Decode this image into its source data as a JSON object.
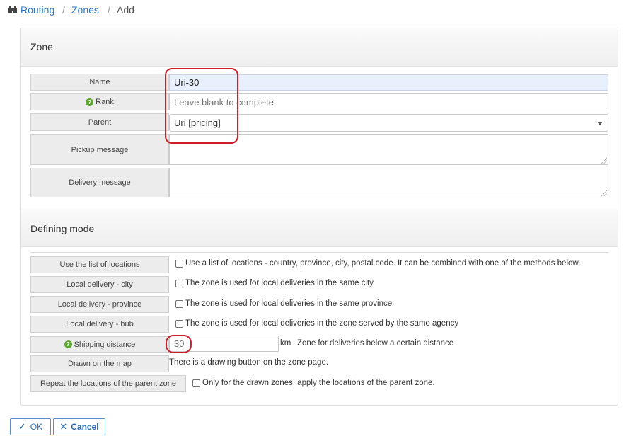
{
  "breadcrumb": {
    "items": [
      "Routing",
      "Zones",
      "Add"
    ],
    "separator": "/",
    "icon": "binoculars-icon"
  },
  "zone_section": {
    "title": "Zone",
    "fields": {
      "name": {
        "label": "Name",
        "value": "Uri-30"
      },
      "rank": {
        "label": "Rank",
        "placeholder": "Leave blank to complete",
        "help_icon": "question-circle-icon"
      },
      "parent": {
        "label": "Parent",
        "selected": "Uri [pricing]"
      },
      "pickup_message": {
        "label": "Pickup message",
        "value": ""
      },
      "delivery_message": {
        "label": "Delivery message",
        "value": ""
      }
    }
  },
  "defining_mode": {
    "title": "Defining mode",
    "rows": {
      "locations": {
        "label": "Use the list of locations",
        "text": "Use a list of locations - country, province, city, postal code. It can be combined with one of the methods below.",
        "checked": false
      },
      "city": {
        "label": "Local delivery - city",
        "text": "The zone is used for local deliveries in the same city",
        "checked": false
      },
      "province": {
        "label": "Local delivery - province",
        "text": "The zone is used for local deliveries in the same province",
        "checked": false
      },
      "hub": {
        "label": "Local delivery - hub",
        "text": "The zone is used for local deliveries in the zone served by the same agency",
        "checked": false
      },
      "distance": {
        "label": "Shipping distance",
        "value": "30",
        "unit": "km",
        "description": "Zone for deliveries below a certain distance"
      },
      "map": {
        "label": "Drawn on the map",
        "text": "There is a drawing button on the zone page."
      },
      "repeat": {
        "label": "Repeat the locations of the parent zone",
        "text": "Only for the drawn zones, apply the locations of the parent zone.",
        "checked": false
      }
    }
  },
  "actions": {
    "ok": "OK",
    "cancel": "Cancel"
  },
  "colors": {
    "link": "#2a7cc7",
    "highlight_ring": "#cc1f2a",
    "help_icon": "#5aa82e",
    "name_input_bg": "#e8f0fe"
  }
}
